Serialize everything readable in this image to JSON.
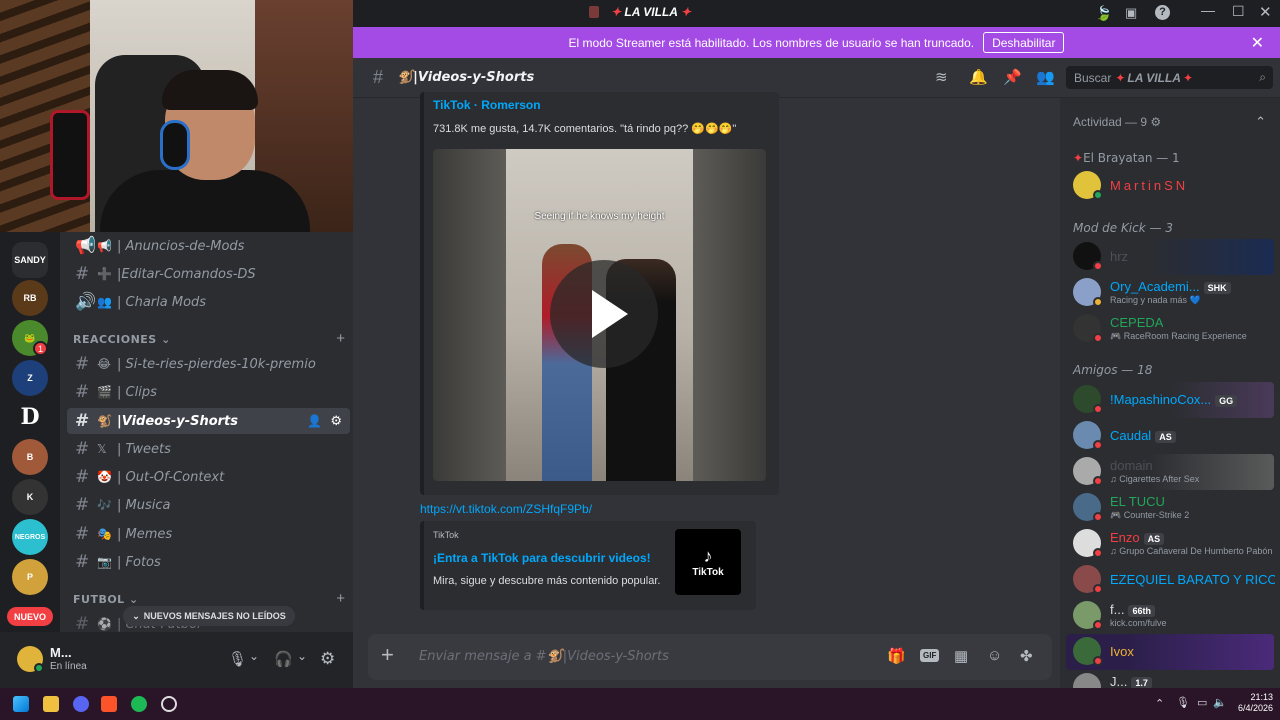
{
  "titlebar": {
    "server_name": "LA VILLA"
  },
  "streamer_banner": {
    "text": "El modo Streamer está habilitado. Los nombres de usuario se han truncado.",
    "button": "Deshabilitar"
  },
  "header": {
    "channel": "🐒|Videos-y-Shorts",
    "search_label": "Buscar",
    "search_server": "LA VILLA"
  },
  "servers": [
    {
      "label": "SANDY",
      "color": "#2b2d31"
    },
    {
      "label": "RB",
      "color": "#5b3a1a"
    },
    {
      "label": "1",
      "color": "#4a8a2c"
    },
    {
      "label": "Z",
      "color": "#1d3f7a"
    },
    {
      "label": "D",
      "color": "#1e1f22"
    },
    {
      "label": "B",
      "color": "#a05a3a"
    },
    {
      "label": "K",
      "color": "#333"
    },
    {
      "label": "NEGROS",
      "color": "#2bbfd0"
    },
    {
      "label": "P",
      "color": "#d1a23b"
    }
  ],
  "server_badge": "1",
  "nuevo_label": "NUEVO",
  "channels": {
    "top": [
      {
        "icon": "📢",
        "emoji": "📢",
        "name": "| Anuncios-de-Mods"
      },
      {
        "icon": "#",
        "emoji": "➕",
        "name": "|Editar-Comandos-DS"
      },
      {
        "icon": "🔊",
        "emoji": "👥",
        "name": "| Charla Mods"
      }
    ],
    "cat1": "REACCIONES",
    "list": [
      {
        "emoji": "😂",
        "name": "| Si-te-ries-pierdes-10k-premio"
      },
      {
        "emoji": "🎬",
        "name": "| Clips"
      },
      {
        "emoji": "🐒",
        "name": "|Videos-y-Shorts",
        "active": true
      },
      {
        "emoji": "𝕏",
        "name": "| Tweets"
      },
      {
        "emoji": "🤡",
        "name": "| Out-Of-Context"
      },
      {
        "emoji": "🎶",
        "name": "| Musica"
      },
      {
        "emoji": "🎭",
        "name": "| Memes"
      },
      {
        "emoji": "📷",
        "name": "| Fotos"
      }
    ],
    "cat2": "FUTBOL",
    "last": {
      "emoji": "⚽",
      "name": "| Chat-Futbol"
    }
  },
  "unread_pill": "NUEVOS MENSAJES NO LEÍDOS",
  "user": {
    "name": "M...",
    "status": "En línea"
  },
  "message": {
    "embed_title": "TikTok · Romerson",
    "embed_desc": "731.8K me gusta, 14.7K comentarios. \"tá rindo pq?? 🤭🤭🤭\"",
    "video_caption": "Seeing if he knows my height",
    "link": "https://vt.tiktok.com/ZSHfqF9Pb/",
    "embed2_provider": "TikTok",
    "embed2_title": "¡Entra a TikTok para descubrir videos!",
    "embed2_desc": "Mira, sigue y descubre más contenido popular.",
    "embed2_thumb": "TikTok"
  },
  "composer": {
    "placeholder": "Enviar mensaje a #🐒|Videos-y-Shorts"
  },
  "members": {
    "activity_header": "Actividad — 9",
    "groups": [
      {
        "title": "El Brayatan — 1",
        "members": [
          {
            "name": "MartinSN",
            "color": "#f23f43",
            "sub": "",
            "tag": ""
          }
        ]
      },
      {
        "title": "Mod de Kick — 3",
        "members": [
          {
            "name": "hrz",
            "color": "#4e5058",
            "sub": "",
            "tag": ""
          },
          {
            "name": "Ory_Academi...",
            "color": "#00a8fc",
            "sub": "Racing y nada más 💙",
            "tag": "SHK"
          },
          {
            "name": "CEPEDA",
            "color": "#23a55a",
            "sub": "🎮 RaceRoom Racing Experience",
            "tag": ""
          }
        ]
      },
      {
        "title": "Amigos — 18",
        "members": [
          {
            "name": "!MapashinoCox...",
            "color": "#00a8fc",
            "sub": "",
            "tag": "GG"
          },
          {
            "name": "Caudal",
            "color": "#00a8fc",
            "sub": "",
            "tag": "AS"
          },
          {
            "name": "domain",
            "color": "#4e5058",
            "sub": "♫ Cigarettes After Sex",
            "tag": ""
          },
          {
            "name": "EL TUCU",
            "color": "#23a55a",
            "sub": "🎮 Counter-Strike 2",
            "tag": ""
          },
          {
            "name": "Enzo",
            "color": "#f23f43",
            "sub": "♫ Grupo Cañaveral De Humberto Pabón",
            "tag": "AS"
          },
          {
            "name": "EZEQUIEL BARATO Y RICO",
            "color": "#00a8fc",
            "sub": "",
            "tag": ""
          },
          {
            "name": "f...",
            "color": "#dbdee1",
            "sub": "kick.com/fulve",
            "tag": "66th"
          },
          {
            "name": "Ivox",
            "color": "#f0b232",
            "sub": "",
            "tag": ""
          },
          {
            "name": "J...",
            "color": "#dbdee1",
            "sub": "",
            "tag": "1.7"
          }
        ]
      }
    ]
  },
  "taskbar": {
    "time": "21:13",
    "date": "6/4/2026"
  }
}
